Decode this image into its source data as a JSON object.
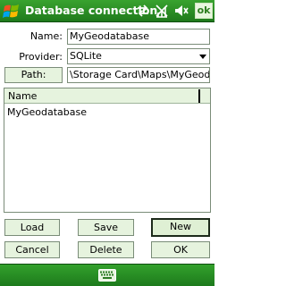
{
  "titlebar": {
    "title": "Database connection",
    "ok_label": "ok"
  },
  "form": {
    "name_label": "Name:",
    "name_value": "MyGeodatabase",
    "provider_label": "Provider:",
    "provider_value": "SQLite",
    "path_button_label": "Path:",
    "path_value": "\\Storage Card\\Maps\\MyGeodat"
  },
  "list": {
    "column_header": "Name",
    "items": [
      "MyGeodatabase"
    ]
  },
  "buttons": {
    "load": "Load",
    "save": "Save",
    "new": "New",
    "cancel": "Cancel",
    "delete": "Delete",
    "ok": "OK"
  },
  "colors": {
    "titlebar_green": "#2a8f25",
    "button_fill": "#e6f3de"
  }
}
